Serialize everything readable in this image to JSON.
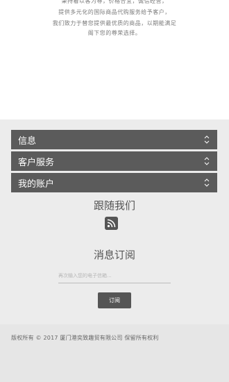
{
  "about": {
    "lines": [
      "秉持着以客为尊，价格合宜，诚信经营，",
      "提供多元化的国际商品代购服务给予客户，",
      "我们致力于替您提供最优质的商品，以期能满足",
      "阁下您的尊荣选择。"
    ]
  },
  "accordion": [
    {
      "label": "信息"
    },
    {
      "label": "客户服务"
    },
    {
      "label": "我的账户"
    }
  ],
  "follow": {
    "title": "跟随我们"
  },
  "newsletter": {
    "title": "消息订阅",
    "placeholder": "再次输入您的电子信箱...",
    "button": "订阅"
  },
  "footer": {
    "copyright": "版权所有 © 2017 厦门港奕致趣贸有限公司 保留所有权利"
  },
  "icons": {
    "accordion": "chevron-up-down-icon",
    "social": "rss-icon"
  }
}
